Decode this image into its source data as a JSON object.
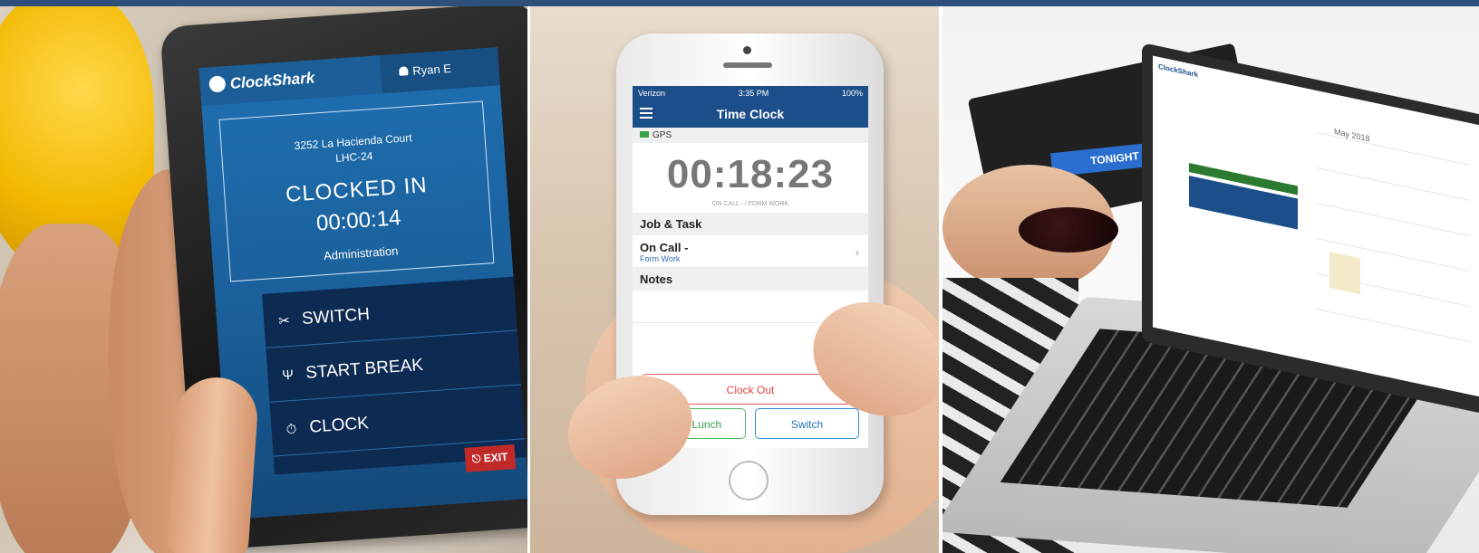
{
  "tablet_app": {
    "logo": "ClockShark",
    "user": "Ryan E",
    "address_line1": "3252 La Hacienda Court",
    "address_line2": "LHC-24",
    "status": "CLOCKED IN",
    "timer": "00:00:14",
    "department": "Administration",
    "actions": [
      {
        "icon": "scissors-icon",
        "glyph": "✂",
        "label": "SWITCH"
      },
      {
        "icon": "fork-knife-icon",
        "glyph": "Ψ",
        "label": "START BREAK"
      },
      {
        "icon": "stopwatch-icon",
        "glyph": "⏱",
        "label": "CLOCK"
      }
    ],
    "exit_label": "EXIT"
  },
  "phone_app": {
    "carrier": "Verizon",
    "time": "3:35 PM",
    "battery": "100%",
    "title": "Time Clock",
    "gps_label": "GPS",
    "timer": "00:18:23",
    "timer_sub": "ON CALL - / FORM WORK",
    "job_section": "Job & Task",
    "job_main": "On Call -",
    "job_sub": "Form Work",
    "notes_section": "Notes",
    "clock_out": "Clock Out",
    "start_lunch": "Start Lunch",
    "switch": "Switch"
  },
  "laptop_app": {
    "brand": "ClockShark",
    "calendar_title": "May 2018",
    "desk_sign": "TONIGHT"
  },
  "colors": {
    "top_bar": "#2d4f7a",
    "tablet_blue": "#1f6fb0",
    "tablet_actions": "#0d2a52",
    "phone_header": "#1c4f8a",
    "clock_out_red": "#e04444",
    "lunch_green": "#3a9e46",
    "switch_blue": "#2577b6",
    "exit_red": "#c22a2a"
  }
}
